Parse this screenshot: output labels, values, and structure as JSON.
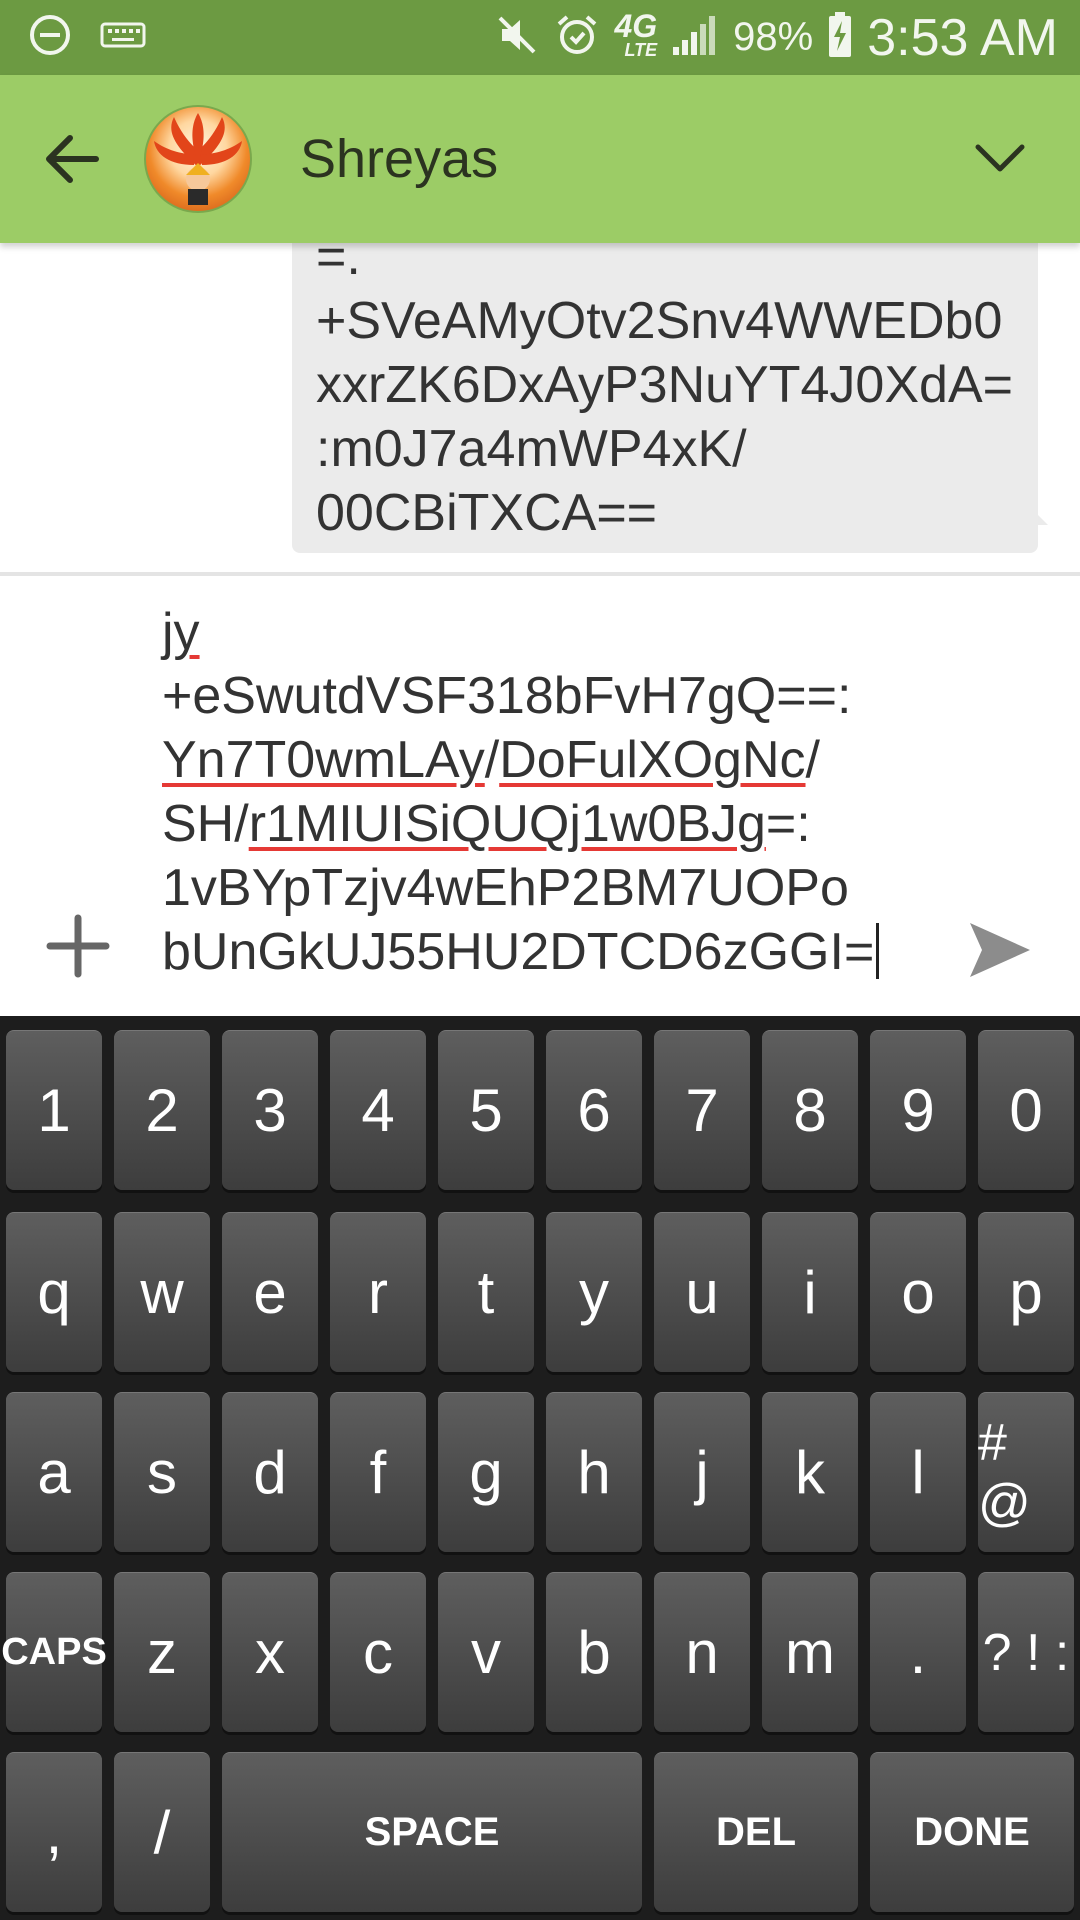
{
  "status_bar": {
    "battery": "98%",
    "time": "3:53 AM",
    "network": "4G",
    "network_sub": "LTE"
  },
  "header": {
    "contact_name": "Shreyas"
  },
  "conversation": {
    "message_lines": [
      "=.",
      "+SVeAMyOtv2Snv4WWEDb0",
      "xxrZK6DxAyP3NuYT4J0XdA=",
      ":m0J7a4mWP4xK/",
      "00CBiTXCA=="
    ]
  },
  "composer": {
    "lines": [
      [
        {
          "t": "jy",
          "err": true
        }
      ],
      [
        {
          "t": "+eSwutdVSF318bFvH7gQ==:",
          "err": false
        }
      ],
      [
        {
          "t": "Yn7T0wmLAy",
          "err": true
        },
        {
          "t": "/",
          "err": false
        },
        {
          "t": "DoFulXOgNc",
          "err": true
        },
        {
          "t": "/",
          "err": false
        }
      ],
      [
        {
          "t": "SH/",
          "err": false
        },
        {
          "t": "r1MIUISiQUQj1w0BJg",
          "err": true
        },
        {
          "t": "=:",
          "err": false
        }
      ],
      [
        {
          "t": "1vBYpTzjv4wEhP2BM7UOPo",
          "err": false
        }
      ],
      [
        {
          "t": "bUnGkUJ55HU2DTCD6zGGI=",
          "err": false
        }
      ]
    ]
  },
  "keyboard": {
    "row1": [
      "1",
      "2",
      "3",
      "4",
      "5",
      "6",
      "7",
      "8",
      "9",
      "0"
    ],
    "row2": [
      "q",
      "w",
      "e",
      "r",
      "t",
      "y",
      "u",
      "i",
      "o",
      "p"
    ],
    "row3": [
      "a",
      "s",
      "d",
      "f",
      "g",
      "h",
      "j",
      "k",
      "l",
      "# @"
    ],
    "row4": [
      "CAPS",
      "z",
      "x",
      "c",
      "v",
      "b",
      "n",
      "m",
      ".",
      "? ! :"
    ],
    "row5": [
      ",",
      "/",
      "SPACE",
      "DEL",
      "DONE"
    ]
  },
  "colors": {
    "status_bar": "#6c9a42",
    "app_bar": "#9ccc66",
    "bubble": "#ebebeb",
    "keyboard_bg": "#1d1d1d"
  }
}
